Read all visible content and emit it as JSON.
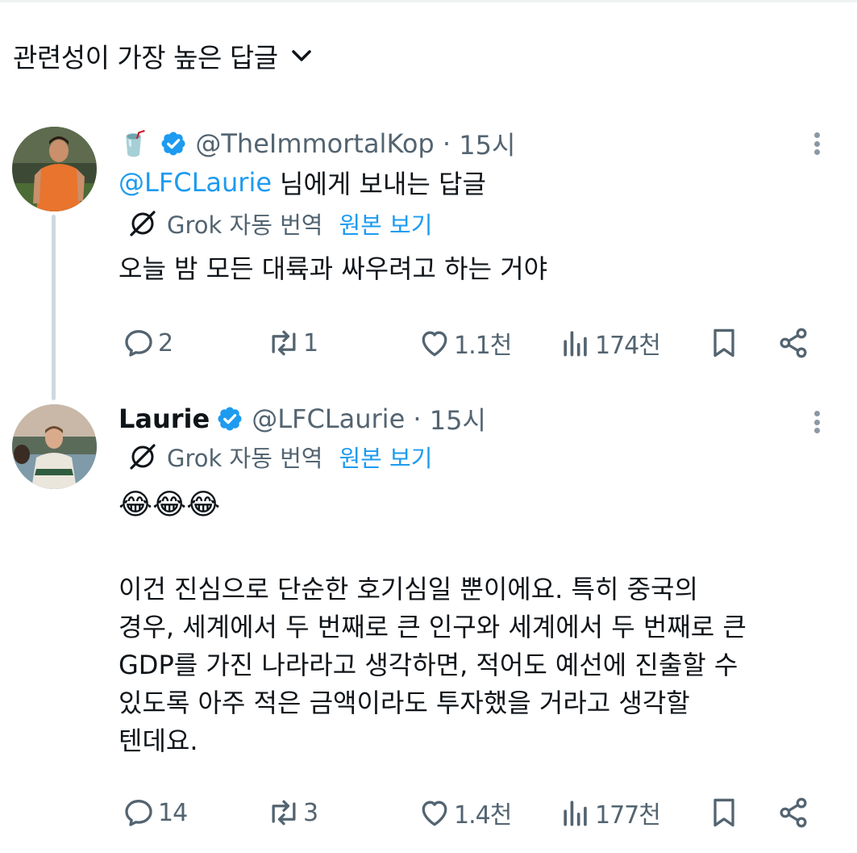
{
  "sort": {
    "label": "관련성이 가장 높은 답글"
  },
  "tweets": [
    {
      "display_name": "🥤",
      "handle": "@TheImmortalKop",
      "time": "15시",
      "reply_to_handle": "@LFCLaurie",
      "reply_to_suffix": "님에게 보내는 답글",
      "translate_label": "Grok 자동 번역",
      "see_original": "원본 보기",
      "text": "오늘 밤 모든 대륙과 싸우려고 하는 거야",
      "stats": {
        "replies": "2",
        "reposts": "1",
        "likes": "1.1천",
        "views": "174천"
      }
    },
    {
      "display_name": "Laurie",
      "handle": "@LFCLaurie",
      "time": "15시",
      "translate_label": "Grok 자동 번역",
      "see_original": "원본 보기",
      "emojis": "😂😂😂",
      "text_lines": [
        "이건 진심으로 단순한 호기심일 뿐이에요. 특히 중국의",
        "경우, 세계에서 두 번째로 큰 인구와 세계에서 두 번째로 큰",
        "GDP를 가진 나라라고 생각하면, 적어도 예선에 진출할 수",
        "있도록 아주 적은 금액이라도 투자했을 거라고 생각할",
        "텐데요."
      ],
      "stats": {
        "replies": "14",
        "reposts": "3",
        "likes": "1.4천",
        "views": "177천"
      }
    }
  ],
  "colors": {
    "accent": "#1d9bf0",
    "muted": "#536471",
    "text": "#0f1419"
  },
  "icons": [
    "chevron-down-icon",
    "verified-icon",
    "more-icon",
    "grok-icon",
    "reply-icon",
    "repost-icon",
    "like-icon",
    "views-icon",
    "bookmark-icon",
    "share-icon"
  ]
}
